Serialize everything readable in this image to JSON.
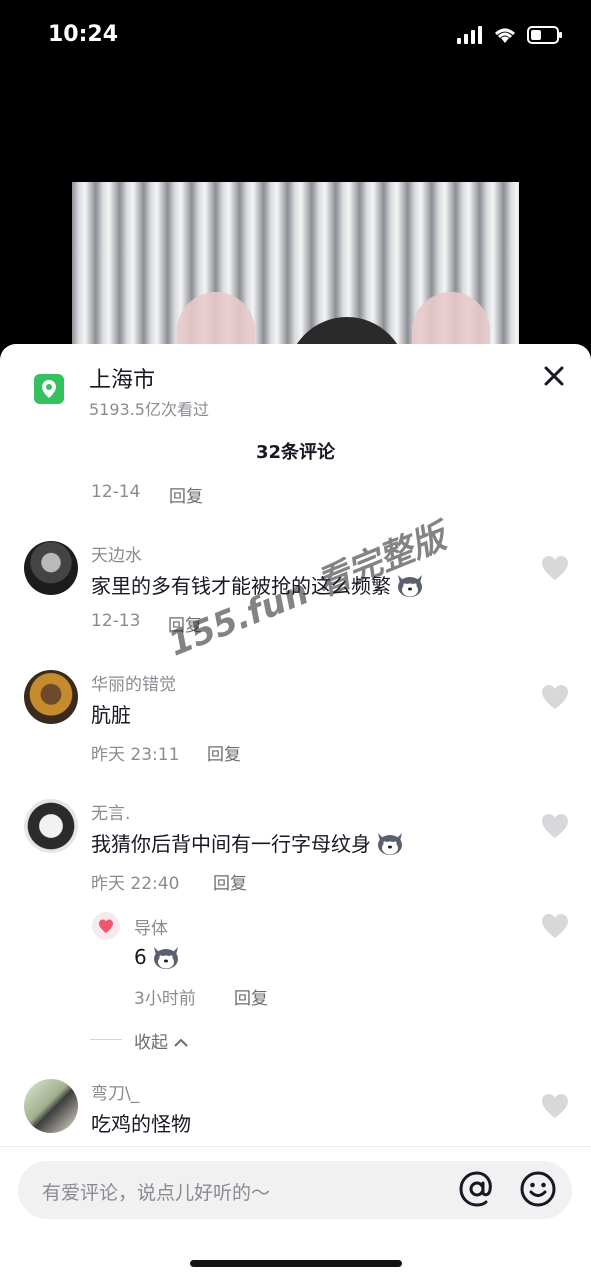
{
  "status": {
    "time": "10:24"
  },
  "location": {
    "title": "上海市",
    "views": "5193.5亿次看过"
  },
  "comments_header": "32条评论",
  "partial": {
    "date": "12-14",
    "reply": "回复"
  },
  "comments": [
    {
      "user": "天边水",
      "text": "家里的多有钱才能被抢的这么频繁",
      "date": "12-13",
      "reply": "回复"
    },
    {
      "user": "华丽的错觉",
      "text": "肮脏",
      "date": "昨天 23:11",
      "reply": "回复"
    },
    {
      "user": "无言.",
      "text": "我猜你后背中间有一行字母纹身",
      "date": "昨天 22:40",
      "reply": "回复"
    },
    {
      "user": "弯刀\\_",
      "text": "吃鸡的怪物"
    }
  ],
  "sub_reply": {
    "user": "导体",
    "text": "6",
    "date": "3小时前",
    "reply": "回复"
  },
  "collapse": "收起",
  "watermark": "155.fun 看完整版",
  "input": {
    "placeholder": "有爱评论，说点儿好听的～"
  },
  "icons": [
    "signal-icon",
    "wifi-icon",
    "battery-icon",
    "location-pin-icon",
    "close-icon",
    "heart-icon",
    "husky-emoji-icon",
    "at-icon",
    "emoji-icon"
  ],
  "colors": {
    "location_green": "#33c25f",
    "reply_heart": "#f0576d",
    "like_gray": "#d8d8da"
  }
}
